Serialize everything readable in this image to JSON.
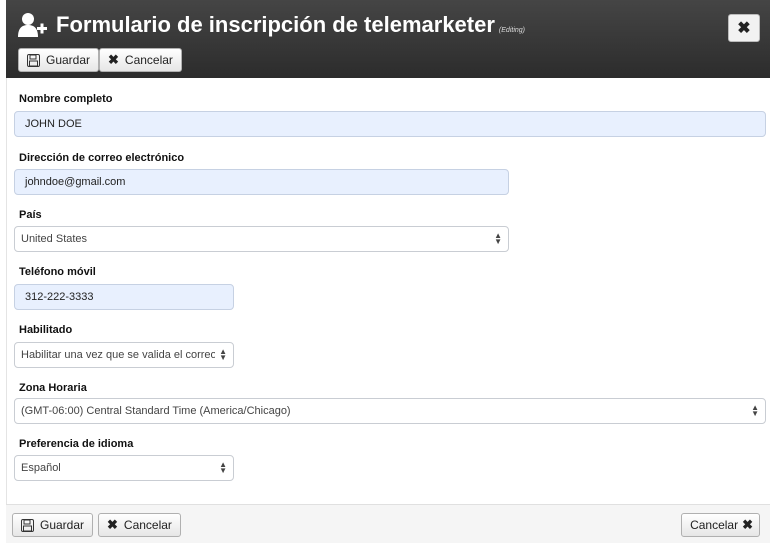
{
  "header": {
    "title": "Formulario de inscripción de telemarketer",
    "subtitle": "(Editing)",
    "title_icon": "user-plus-icon",
    "close_icon": "close-icon",
    "save_label": "Guardar",
    "cancel_label": "Cancelar"
  },
  "form": {
    "name_label": "Nombre completo",
    "name_value": "JOHN DOE",
    "email_label": "Dirección de correo electrónico",
    "email_value": "johndoe@gmail.com",
    "country_label": "País",
    "country_value": "United States",
    "phone_label": "Teléfono móvil",
    "phone_value": "312-222-3333",
    "enabled_label": "Habilitado",
    "enabled_value": "Habilitar una vez que se valida el correo e",
    "timezone_label": "Zona Horaria",
    "timezone_value": "(GMT-06:00) Central Standard Time (America/Chicago)",
    "language_label": "Preferencia de idioma",
    "language_value": "Español"
  },
  "footer": {
    "save_label": "Guardar",
    "cancel_label": "Cancelar",
    "cancel_right_label": "Cancelar"
  },
  "colors": {
    "header_bg": "#333333",
    "filled_field_bg": "#e8f0fe"
  }
}
